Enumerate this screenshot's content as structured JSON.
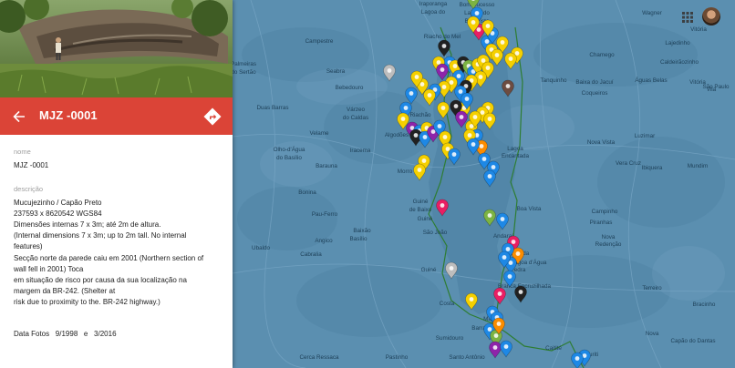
{
  "feature": {
    "title": "MJZ -0001",
    "fields": [
      {
        "label": "nome",
        "lines": [
          "MJZ -0001"
        ]
      },
      {
        "label": "descrição",
        "lines": [
          "Mucujezinho / Capão Preto",
          "237593 x 8620542    WGS84",
          "Dimensões internas 7 x 3m; até 2m de altura.",
          "(Internal dimensions 7 x 3m; up to 2m tall. No internal",
          "features)",
          "Secção norte da parede caiu em 2001  (Northern section of",
          "wall fell in 2001)                                          Toca",
          "em situação de risco por causa da sua localização na",
          "margem da BR-242.                       (Shelter at",
          "risk due to proximity to the. BR-242 highway.)"
        ]
      }
    ],
    "date_row": "Data Fotos   9/1998   e   3/2016"
  },
  "icons": {
    "back": "arrow-back-icon",
    "directions": "directions-icon",
    "apps": "apps-grid-icon",
    "account": "account-avatar"
  },
  "colors": {
    "accent": "#db4437",
    "map_water": "#5b8fb0",
    "marker_yellow": "#f5d000",
    "marker_blue": "#1e88e5",
    "marker_purple": "#8e24aa",
    "marker_pink": "#e91e63",
    "marker_black": "#212121",
    "marker_orange": "#fb8c00",
    "marker_green": "#7cb342",
    "marker_brown": "#6d4c41",
    "marker_grey": "#bdbdbd",
    "boundary": "#2e7d32"
  },
  "places": [
    "Bom Sucesso",
    "Lajedo do",
    "Boa Vista",
    "Iraporanga",
    "Lagoa do",
    "Wagner",
    "Riacho do Mel",
    "Vitória",
    "Lajedinho",
    "Campestre",
    "Chamego",
    "Caldeirãozinho",
    "Palmeiras",
    "do Sertão",
    "Seabra",
    "Bebedouro",
    "Baixa do Jacuí",
    "Coqueiros",
    "Vitória",
    "Vila",
    "São Paulo",
    "Águas Belas",
    "Tanquinho",
    "Duas Barras",
    "Várzeo",
    "do Caldas",
    "Riachão",
    "Velame",
    "Algodões",
    "Olho-d'Água",
    "do Basílio",
    "Iracema",
    "Lagoa",
    "Encantada",
    "Nova Vista",
    "Luzimar",
    "Vera Cruz",
    "Barauna",
    "Morro",
    "Mundim",
    "Ibiquera",
    "Bonina",
    "Guiné",
    "de Baixo",
    "Guiné",
    "Boa Vista",
    "Campinho",
    "Pau-Ferro",
    "São João",
    "Baixão",
    "Basílio",
    "Angico",
    "Piranhas",
    "Nova",
    "Redenção",
    "Ubaldo",
    "Cabralia",
    "Andaraí",
    "Guiné",
    "Fazenda",
    "Lagoa d'Água",
    "Pedra",
    "Branca Encruzilhada",
    "Terreiro",
    "Costa",
    "Maria",
    "Barra",
    "Sumidouro",
    "Santo Antônio",
    "Pastinho",
    "Cerca Ressaca",
    "Capão do Dantas",
    "Nova",
    "Bracinho",
    "Caitité",
    "Buriti"
  ]
}
